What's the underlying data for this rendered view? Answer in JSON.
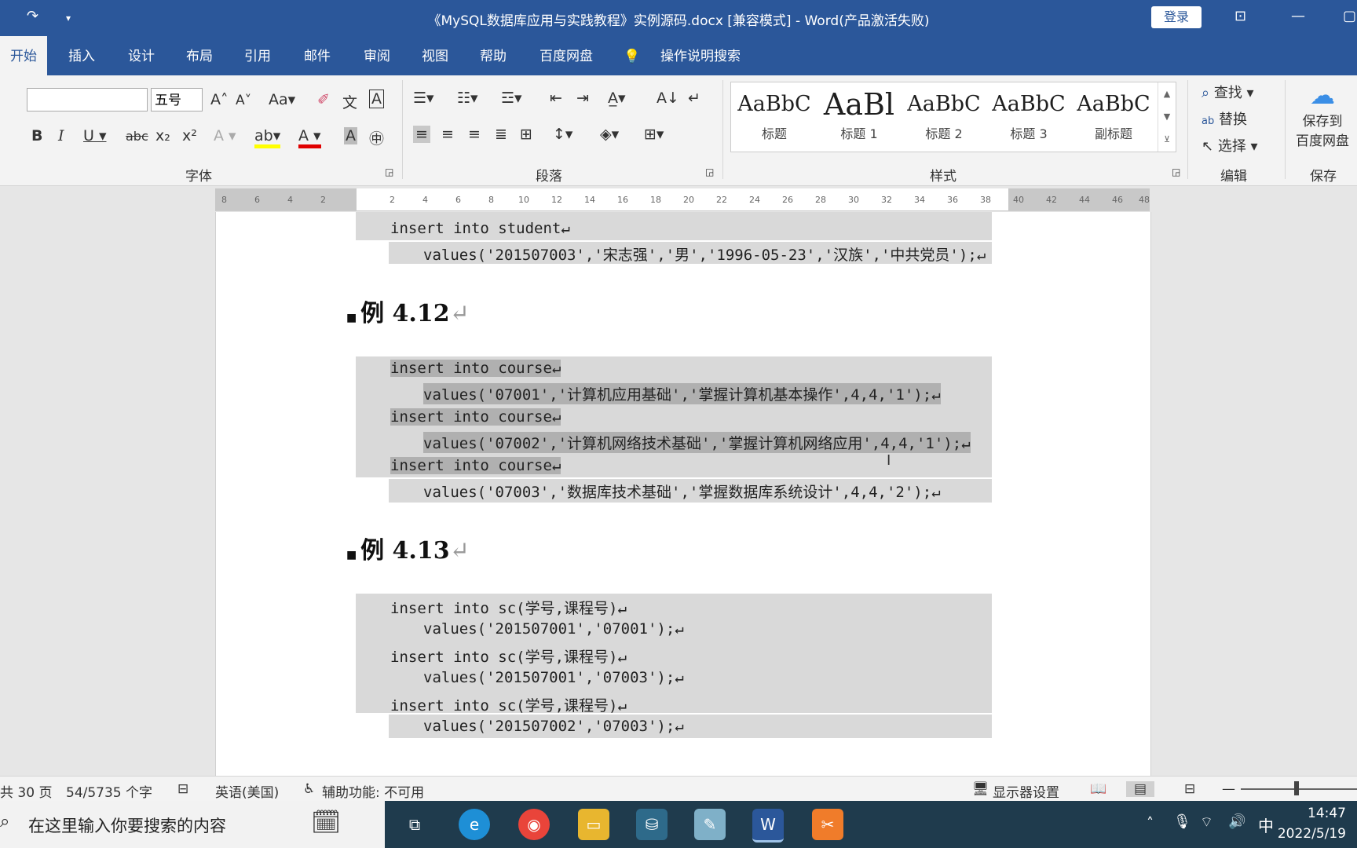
{
  "titlebar": {
    "title": "《MySQL数据库应用与实践教程》实例源码.docx [兼容模式]  -  Word(产品激活失败)",
    "login": "登录"
  },
  "tabs": [
    "开始",
    "插入",
    "设计",
    "布局",
    "引用",
    "邮件",
    "审阅",
    "视图",
    "帮助",
    "百度网盘"
  ],
  "tell_me": "操作说明搜索",
  "font": {
    "name_value": "",
    "size_value": "五号",
    "group_label": "字体"
  },
  "paragraph": {
    "group_label": "段落"
  },
  "styles": {
    "group_label": "样式",
    "items": [
      {
        "sample": "AaBbC",
        "name": "标题"
      },
      {
        "sample": "AaBl",
        "name": "标题 1"
      },
      {
        "sample": "AaBbC",
        "name": "标题 2"
      },
      {
        "sample": "AaBbC",
        "name": "标题 3"
      },
      {
        "sample": "AaBbC",
        "name": "副标题"
      }
    ]
  },
  "editing": {
    "group_label": "编辑",
    "find": "查找",
    "replace": "替换",
    "select": "选择"
  },
  "save": {
    "group_label": "保存",
    "label1": "保存到",
    "label2": "百度网盘"
  },
  "ruler": [
    "8",
    "6",
    "4",
    "2",
    "2",
    "4",
    "6",
    "8",
    "10",
    "12",
    "14",
    "16",
    "18",
    "20",
    "22",
    "24",
    "26",
    "28",
    "30",
    "32",
    "34",
    "36",
    "38",
    "40",
    "42",
    "44",
    "46",
    "48"
  ],
  "document": {
    "block0": [
      "insert into student↵",
      "values('201507003','宋志强','男','1996-05-23','汉族','中共党员');↵"
    ],
    "heading1": "例 4.12",
    "block1": [
      "insert into course↵",
      "values('07001','计算机应用基础','掌握计算机基本操作',4,4,'1');↵",
      "insert into course↵",
      "values('07002','计算机网络技术基础','掌握计算机网络应用',4,4,'1');↵",
      "insert into course↵",
      "values('07003','数据库技术基础','掌握数据库系统设计',4,4,'2');↵"
    ],
    "heading2": "例 4.13",
    "block2": [
      "insert into sc(学号,课程号)↵",
      "values('201507001','07001');↵",
      "insert into sc(学号,课程号)↵",
      "values('201507001','07003');↵",
      "insert into sc(学号,课程号)↵",
      "values('201507002','07003');↵"
    ]
  },
  "status": {
    "pages": "共 30 页",
    "words": "54/5735 个字",
    "language": "英语(美国)",
    "accessibility": "辅助功能: 不可用",
    "display_settings": "显示器设置"
  },
  "taskbar": {
    "search_placeholder": "在这里输入你要搜索的内容",
    "ime": "中",
    "time": "14:47",
    "date": "2022/5/19"
  }
}
